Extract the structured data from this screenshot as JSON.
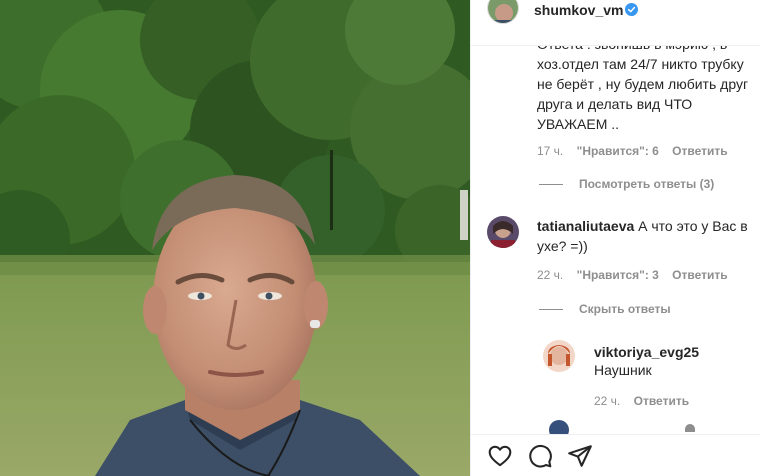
{
  "post": {
    "username": "shumkov_vm",
    "verified": true
  },
  "comments": {
    "first": {
      "partial_top_line": "Ответа : звонишь в мэрию , в",
      "lines": [
        "хоз.отдел там 24/7 никто трубку",
        "не берёт , ну будем любить друг",
        "друга и делать вид ЧТО",
        "УВАЖАЕМ .."
      ],
      "time": "17 ч.",
      "likes": "\"Нравится\": 6",
      "reply": "Ответить",
      "view_replies": "Посмотреть ответы (3)"
    },
    "second": {
      "author": "tatianaliutaeva",
      "line1": "А что это у Вас в",
      "line2": "ухе? =))",
      "time": "22 ч.",
      "likes": "\"Нравится\": 3",
      "reply": "Ответить",
      "hide_replies": "Скрыть ответы"
    },
    "reply": {
      "author": "viktoriya_evg25",
      "text": "Наушник",
      "time": "22 ч.",
      "reply": "Ответить"
    }
  },
  "icons": {
    "like": "heart-icon",
    "comment": "comment-bubble-icon",
    "share": "paper-plane-icon",
    "verified": "verified-badge-icon"
  },
  "colors": {
    "verified_blue": "#3897f0",
    "muted_text": "#8e8e8e",
    "primary_text": "#262626"
  }
}
